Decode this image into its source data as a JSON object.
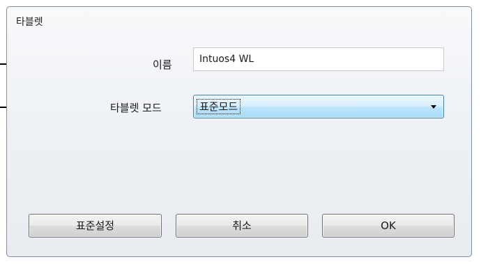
{
  "dialog": {
    "title": "타블렛"
  },
  "form": {
    "name_label": "이름",
    "name_value": "Intuos4 WL",
    "mode_label": "타블렛 모드",
    "mode_selected": "표준모드"
  },
  "buttons": {
    "defaults_label": "표준설정",
    "cancel_label": "취소",
    "ok_label": "OK"
  },
  "icons": {
    "dropdown": "chevron-down-icon"
  }
}
